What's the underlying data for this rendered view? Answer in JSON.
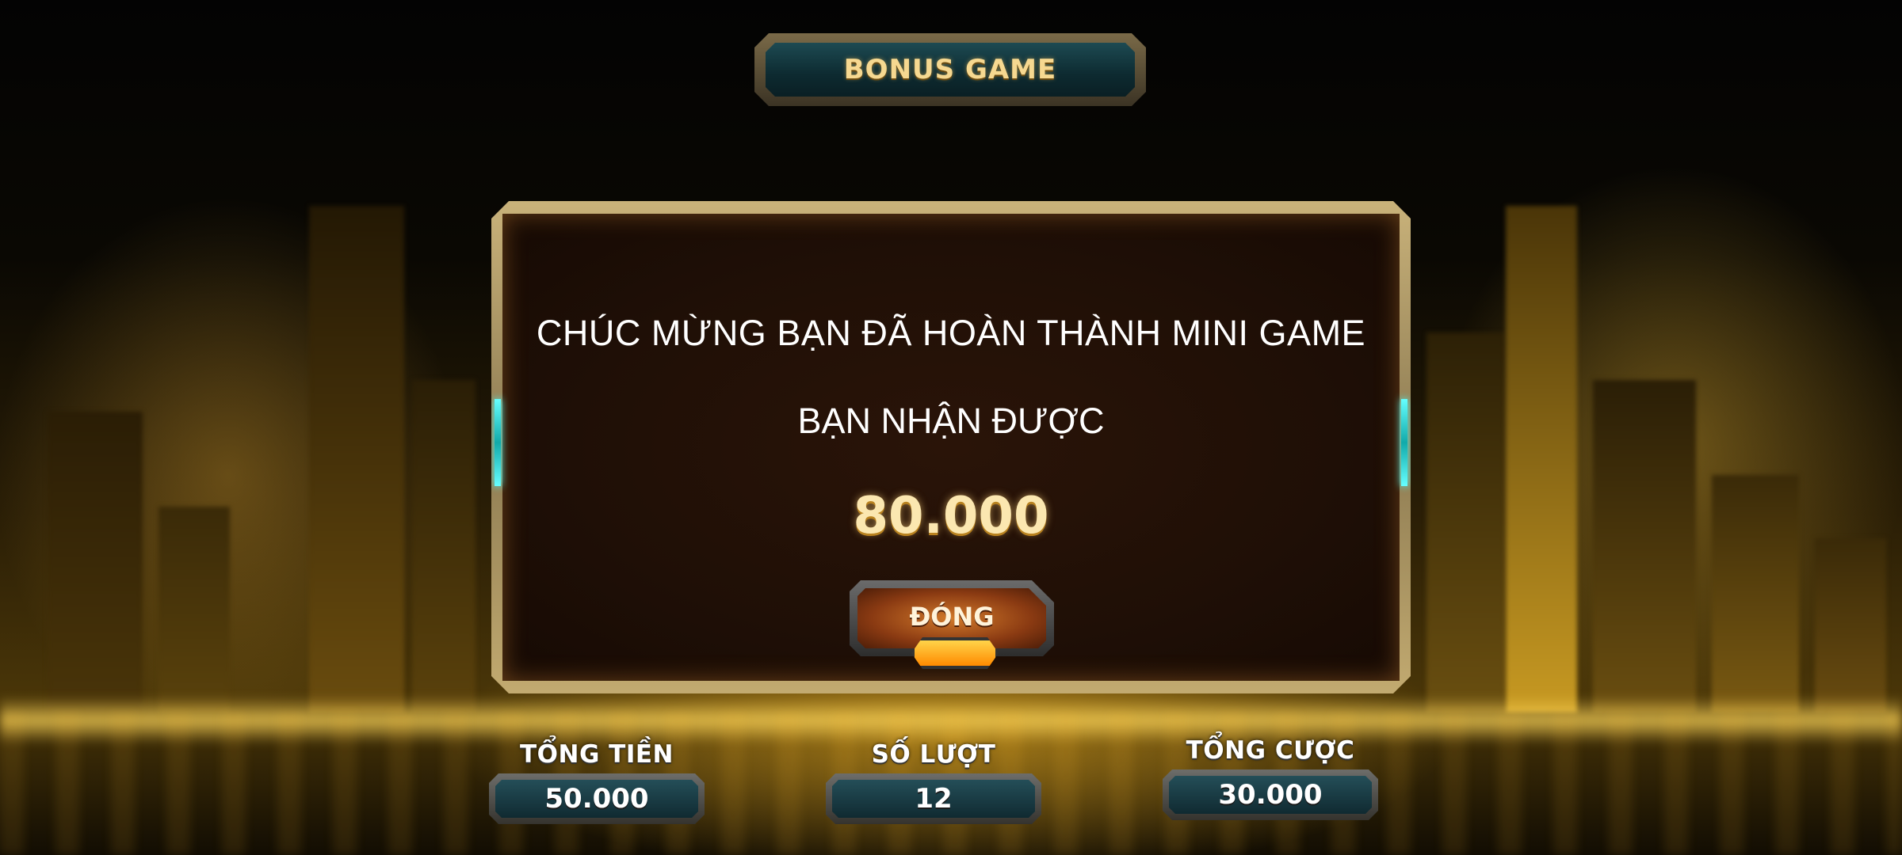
{
  "header": {
    "title": "BONUS GAME"
  },
  "dialog": {
    "message_line1": "CHÚC MỪNG BẠN ĐÃ HOÀN THÀNH MINI GAME",
    "message_line2": "BẠN NHẬN ĐƯỢC",
    "amount": "80.000",
    "close_label": "ĐÓNG"
  },
  "stats": [
    {
      "label": "TỔNG TIỀN",
      "value": "50.000"
    },
    {
      "label": "SỐ LƯỢT",
      "value": "12"
    },
    {
      "label": "TỔNG CƯỢC",
      "value": "30.000"
    }
  ],
  "colors": {
    "accent_gold": "#f6d890",
    "panel_teal": "#1d4a52",
    "button_orange": "#d27a2a",
    "frame_cyan": "#66ffff"
  }
}
